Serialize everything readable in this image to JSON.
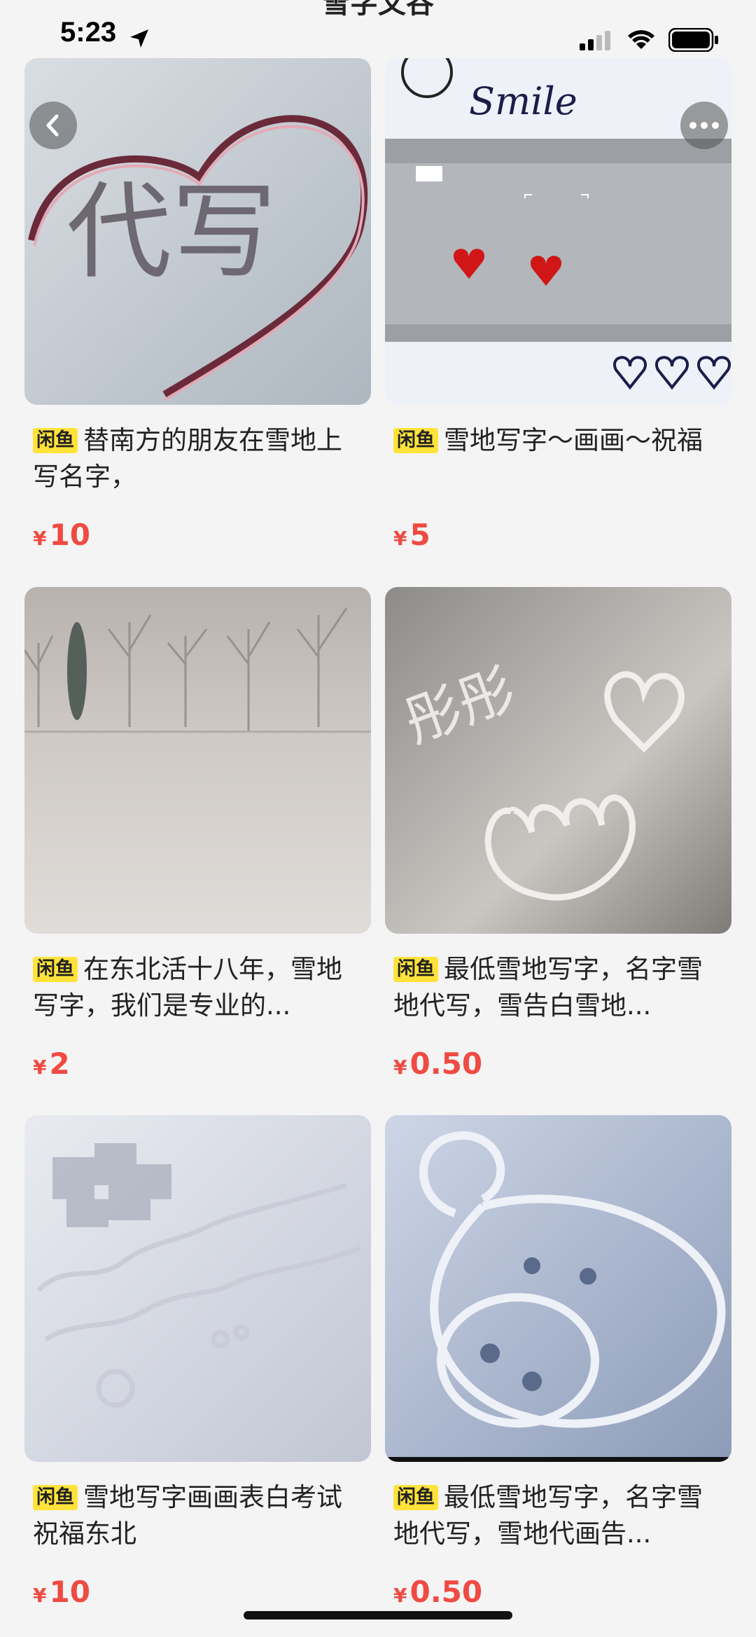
{
  "header": {
    "title": "雪字文谷"
  },
  "status_bar": {
    "time": "5:23"
  },
  "items": [
    {
      "badge": "闲鱼",
      "title": "替南方的朋友在雪地上写名字，",
      "currency": "¥",
      "price": "10",
      "image_text": "代写"
    },
    {
      "badge": "闲鱼",
      "title": "雪地写字～画画～祝福",
      "currency": "¥",
      "price": "5",
      "image_text": "Smile"
    },
    {
      "badge": "闲鱼",
      "title": "在东北活十八年，雪地写字，我们是专业的...",
      "currency": "¥",
      "price": "2"
    },
    {
      "badge": "闲鱼",
      "title": "最低雪地写字，名字雪地代写，雪告白雪地...",
      "currency": "¥",
      "price": "0.50",
      "image_text": "彤彤"
    },
    {
      "badge": "闲鱼",
      "title": "雪地写字画画表白考试祝福东北",
      "currency": "¥",
      "price": "10"
    },
    {
      "badge": "闲鱼",
      "title": "最低雪地写字，名字雪地代写，雪地代画告...",
      "currency": "¥",
      "price": "0.50"
    }
  ],
  "icons": {
    "back": "back-chevron-icon",
    "more": "more-dots-icon",
    "location": "location-arrow-icon",
    "signal": "signal-icon",
    "wifi": "wifi-icon",
    "battery": "battery-icon"
  },
  "colors": {
    "price": "#ef4b43",
    "badge": "#ffe33a",
    "background": "#f4f4f4"
  }
}
